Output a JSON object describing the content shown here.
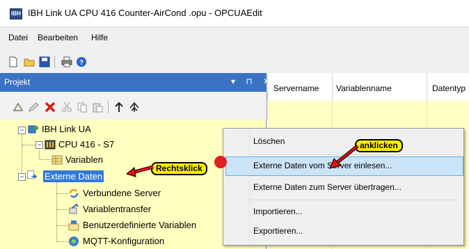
{
  "window": {
    "title": "IBH Link UA CPU 416 Counter-AirCond .opu - OPCUAEdit",
    "app_icon_text": "IBH"
  },
  "menu": {
    "items": [
      "Datei",
      "Bearbeiten",
      "Hilfe"
    ]
  },
  "toolbar": {
    "buttons": [
      "new-file-icon",
      "open-folder-icon",
      "save-icon",
      "print-icon",
      "help-icon"
    ]
  },
  "panel": {
    "title": "Projekt",
    "controls": "▾ ⊓ ✕",
    "toolbar_buttons": [
      "add-variable-icon",
      "edit-icon",
      "delete-icon",
      "cut-icon",
      "copy-icon",
      "paste-icon",
      "move-up-icon",
      "move-top-icon"
    ]
  },
  "tree": {
    "root": "IBH Link UA",
    "cpu": "CPU 416 - S7",
    "variablen": "Variablen",
    "externe_daten": "Externe Daten",
    "verbundene_server": "Verbundene Server",
    "variablentransfer": "Variablentransfer",
    "benutzerdefinierte": "Benutzerdefinierte Variablen",
    "mqtt": "MQTT-Konfiguration"
  },
  "grid": {
    "columns": [
      "Servername",
      "Variablenname",
      "Datentyp"
    ]
  },
  "context_menu": {
    "items": [
      "Löschen",
      "Externe Daten vom Server einlesen...",
      "Externe Daten zum Server übertragen...",
      "Importieren...",
      "Exportieren..."
    ],
    "highlighted_index": 1
  },
  "annotations": {
    "rechtsklick": "Rechtsklick",
    "anklicken": "anklicken",
    "callout_color": "#ffef00",
    "arrow_color": "#e01010"
  },
  "colors": {
    "tree_bg": "#ffffbf",
    "panel_header": "#3a73c5",
    "selection": "#3479d6",
    "grid_bg": "#ffffc4"
  }
}
